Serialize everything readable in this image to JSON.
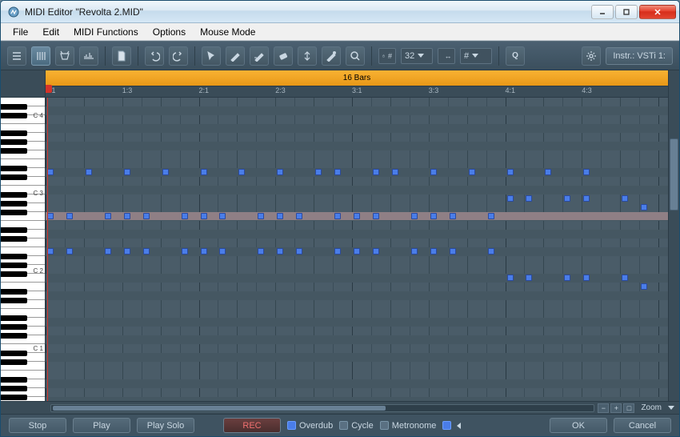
{
  "window": {
    "title": "MIDI Editor \"Revolta 2.MID\""
  },
  "menubar": [
    "File",
    "Edit",
    "MIDI Functions",
    "Options",
    "Mouse Mode"
  ],
  "toolbar": {
    "quantize_value": "32",
    "length_value": "#",
    "instr_label": "Instr.: VSTi 1:"
  },
  "timeline": {
    "label": "16 Bars",
    "ticks": [
      "1:1",
      "1:3",
      "2:1",
      "2:3",
      "3:1",
      "3:3",
      "4:1",
      "4:3"
    ]
  },
  "piano": {
    "octaves": [
      "C 4",
      "C 3",
      "C 2",
      "C 1"
    ]
  },
  "zoom": {
    "label": "Zoom"
  },
  "footer": {
    "stop": "Stop",
    "play": "Play",
    "play_solo": "Play Solo",
    "rec": "REC",
    "overdub": "Overdub",
    "cycle": "Cycle",
    "metronome": "Metronome",
    "ok": "OK",
    "cancel": "Cancel"
  },
  "notes": [
    {
      "row": 8,
      "col": 0
    },
    {
      "row": 8,
      "col": 2
    },
    {
      "row": 8,
      "col": 4
    },
    {
      "row": 8,
      "col": 6
    },
    {
      "row": 8,
      "col": 8
    },
    {
      "row": 8,
      "col": 10
    },
    {
      "row": 8,
      "col": 12
    },
    {
      "row": 8,
      "col": 14
    },
    {
      "row": 8,
      "col": 15
    },
    {
      "row": 8,
      "col": 17
    },
    {
      "row": 8,
      "col": 18
    },
    {
      "row": 8,
      "col": 20
    },
    {
      "row": 8,
      "col": 22
    },
    {
      "row": 8,
      "col": 24
    },
    {
      "row": 8,
      "col": 26
    },
    {
      "row": 8,
      "col": 28
    },
    {
      "row": 11,
      "col": 24
    },
    {
      "row": 11,
      "col": 25
    },
    {
      "row": 11,
      "col": 27
    },
    {
      "row": 11,
      "col": 28
    },
    {
      "row": 11,
      "col": 30
    },
    {
      "row": 12,
      "col": 31
    },
    {
      "row": 13,
      "col": 0
    },
    {
      "row": 13,
      "col": 1
    },
    {
      "row": 13,
      "col": 3
    },
    {
      "row": 13,
      "col": 4
    },
    {
      "row": 13,
      "col": 5
    },
    {
      "row": 13,
      "col": 7
    },
    {
      "row": 13,
      "col": 8
    },
    {
      "row": 13,
      "col": 9
    },
    {
      "row": 13,
      "col": 11
    },
    {
      "row": 13,
      "col": 12
    },
    {
      "row": 13,
      "col": 13
    },
    {
      "row": 13,
      "col": 15
    },
    {
      "row": 13,
      "col": 16
    },
    {
      "row": 13,
      "col": 17
    },
    {
      "row": 13,
      "col": 19
    },
    {
      "row": 13,
      "col": 20
    },
    {
      "row": 13,
      "col": 21
    },
    {
      "row": 13,
      "col": 23
    },
    {
      "row": 17,
      "col": 0
    },
    {
      "row": 17,
      "col": 1
    },
    {
      "row": 17,
      "col": 3
    },
    {
      "row": 17,
      "col": 4
    },
    {
      "row": 17,
      "col": 5
    },
    {
      "row": 17,
      "col": 7
    },
    {
      "row": 17,
      "col": 8
    },
    {
      "row": 17,
      "col": 9
    },
    {
      "row": 17,
      "col": 11
    },
    {
      "row": 17,
      "col": 12
    },
    {
      "row": 17,
      "col": 13
    },
    {
      "row": 17,
      "col": 15
    },
    {
      "row": 17,
      "col": 16
    },
    {
      "row": 17,
      "col": 17
    },
    {
      "row": 17,
      "col": 19
    },
    {
      "row": 17,
      "col": 20
    },
    {
      "row": 17,
      "col": 21
    },
    {
      "row": 17,
      "col": 23
    },
    {
      "row": 20,
      "col": 24
    },
    {
      "row": 20,
      "col": 25
    },
    {
      "row": 20,
      "col": 27
    },
    {
      "row": 20,
      "col": 28
    },
    {
      "row": 20,
      "col": 30
    },
    {
      "row": 21,
      "col": 31
    }
  ]
}
